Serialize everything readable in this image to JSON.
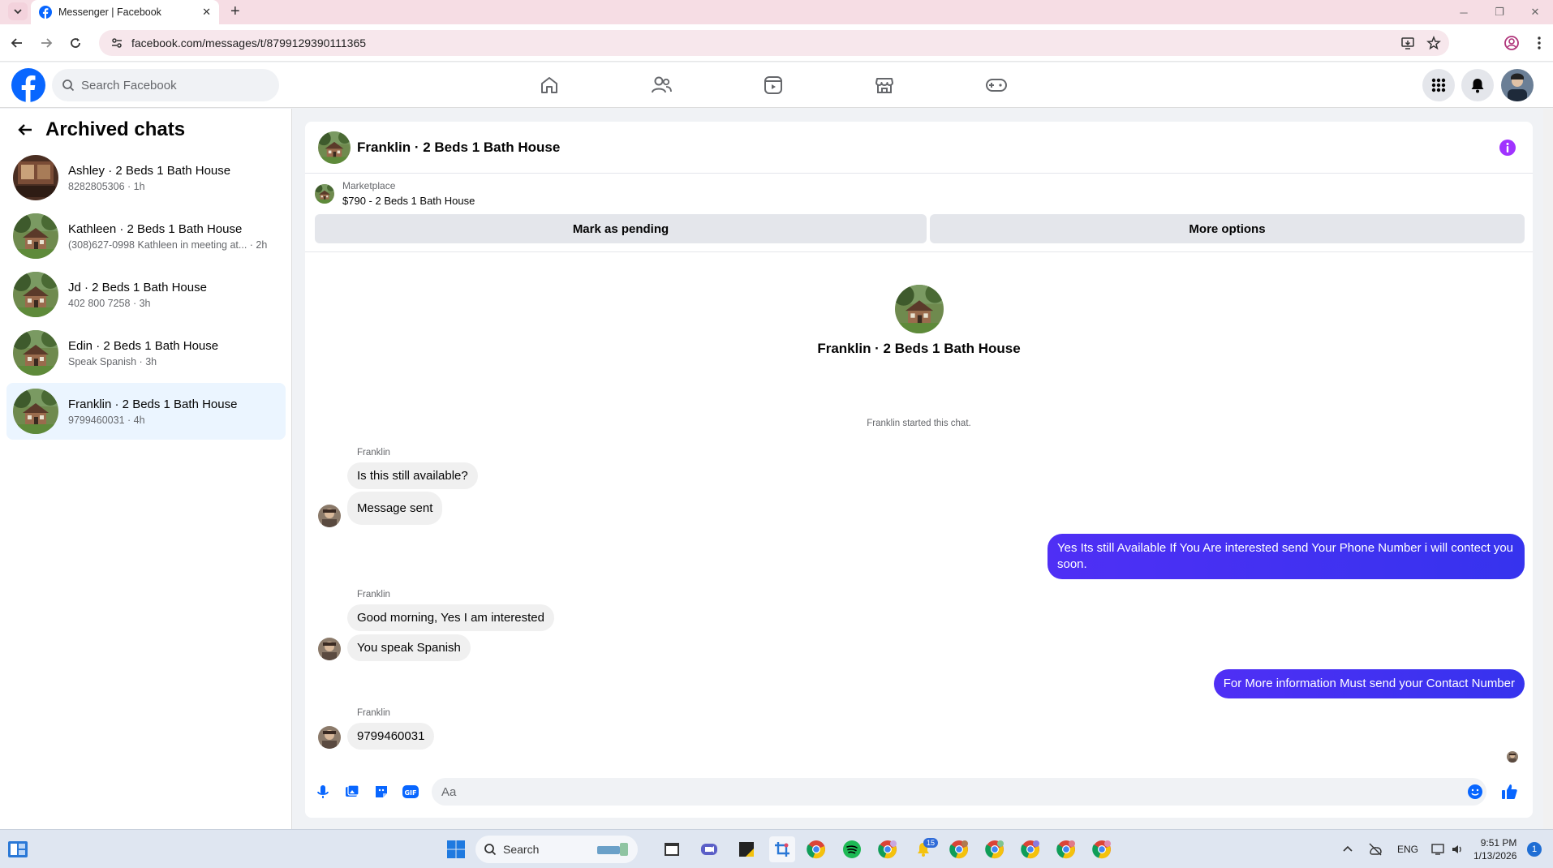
{
  "browser": {
    "tab_title": "Messenger | Facebook",
    "url": "facebook.com/messages/t/8799129390111365"
  },
  "fb": {
    "search_placeholder": "Search Facebook",
    "brand_color": "#0866ff"
  },
  "sidebar": {
    "title": "Archived chats",
    "chats": [
      {
        "name": "Ashley · 2 Beds 1 Bath House",
        "sub": "8282805306 · 1h",
        "active": false
      },
      {
        "name": "Kathleen · 2 Beds 1 Bath House",
        "sub": "(308)627-0998 Kathleen in meeting at... · 2h",
        "active": false
      },
      {
        "name": "Jd · 2 Beds 1 Bath House",
        "sub": "402 800 7258 · 3h",
        "active": false
      },
      {
        "name": "Edin · 2 Beds 1 Bath House",
        "sub": "Speak Spanish · 3h",
        "active": false
      },
      {
        "name": "Franklin · 2 Beds 1 Bath House",
        "sub": "9799460031 · 4h",
        "active": true
      }
    ]
  },
  "conversation": {
    "title": "Franklin · 2 Beds 1 Bath House",
    "marketplace_label": "Marketplace",
    "listing": "$790 - 2 Beds 1 Bath House",
    "mark_pending_label": "Mark as pending",
    "more_options_label": "More options",
    "intro_name": "Franklin · 2 Beds 1 Bath House",
    "started_text": "Franklin started this chat.",
    "sender_name": "Franklin",
    "messages": {
      "in1": "Is this still available?",
      "in2": "Message sent",
      "out1": "Yes Its still Available If You Are interested send Your Phone Number i will contect you soon.",
      "in3": "Good morning, Yes I am interested",
      "in4": "You speak Spanish",
      "out2": "For More information Must send your Contact Number",
      "in5": "9799460031"
    },
    "composer_placeholder": "Aa",
    "outgoing_color": "#3b35ee"
  },
  "taskbar": {
    "search_label": "Search",
    "notification_badge": "15",
    "lang": "ENG",
    "time": "9:51 PM",
    "date": "1/13/2026",
    "tray_badge": "1"
  }
}
